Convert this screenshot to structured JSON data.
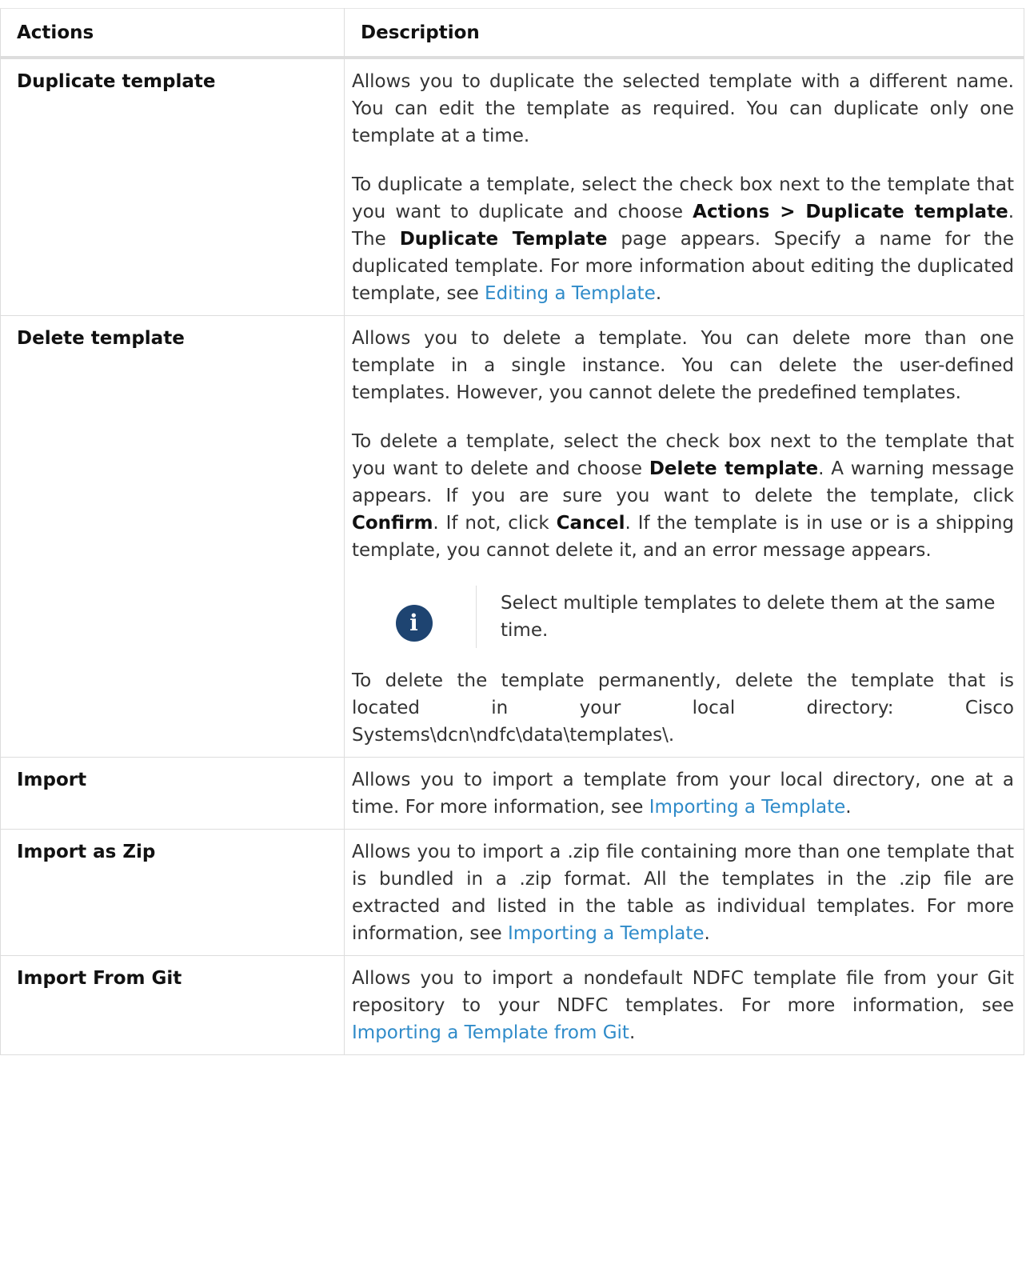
{
  "table": {
    "headers": [
      "Actions",
      "Description"
    ],
    "rows": [
      {
        "action": "Duplicate template",
        "p1": "Allows you to duplicate the selected template with a different name. You can edit the template as required. You can duplicate only one template at a time.",
        "p2a": "To duplicate a template, select the check box next to the template that you want to duplicate and choose ",
        "p2b": "Actions > Duplicate template",
        "p2c": ". The ",
        "p2d": "Duplicate Template",
        "p2e": " page appears. Specify a name for the duplicated template. For more information about editing the duplicated template, see ",
        "p2link": "Editing a Template",
        "p2f": "."
      },
      {
        "action": "Delete template",
        "p1": "Allows you to delete a template. You can delete more than one template in a single instance. You can delete the user-defined templates. However, you cannot delete the predefined templates.",
        "p2a": "To delete a template, select the check box next to the template that you want to delete and choose ",
        "p2b": "Delete template",
        "p2c": ". A warning message appears. If you are sure you want to delete the template, click ",
        "p2d": "Confirm",
        "p2e": ". If not, click ",
        "p2f": "Cancel",
        "p2g": ". If the template is in use or is a shipping template, you cannot delete it, and an error message appears.",
        "note_icon": "info-icon",
        "note": "Select multiple templates to delete them at the same time.",
        "p3": "To delete the template permanently, delete the template that is located in your local directory: Cisco Systems\\dcn\\ndfc\\data\\templates\\."
      },
      {
        "action": "Import",
        "p1a": "Allows you to import a template from your local directory, one at a time. For more information, see ",
        "p1link": "Importing a Template",
        "p1b": "."
      },
      {
        "action": "Import as Zip",
        "p1a": "Allows you to import a .zip file containing more than one template that is bundled in a .zip format. All the templates in the .zip file are extracted and listed in the table as individual templates. For more information, see ",
        "p1link": "Importing a Template",
        "p1b": "."
      },
      {
        "action": "Import From Git",
        "p1a": "Allows you to import a nondefault NDFC template file from your Git repository to your NDFC templates. For more information, see ",
        "p1link": "Importing a Template from Git",
        "p1b": "."
      }
    ]
  }
}
